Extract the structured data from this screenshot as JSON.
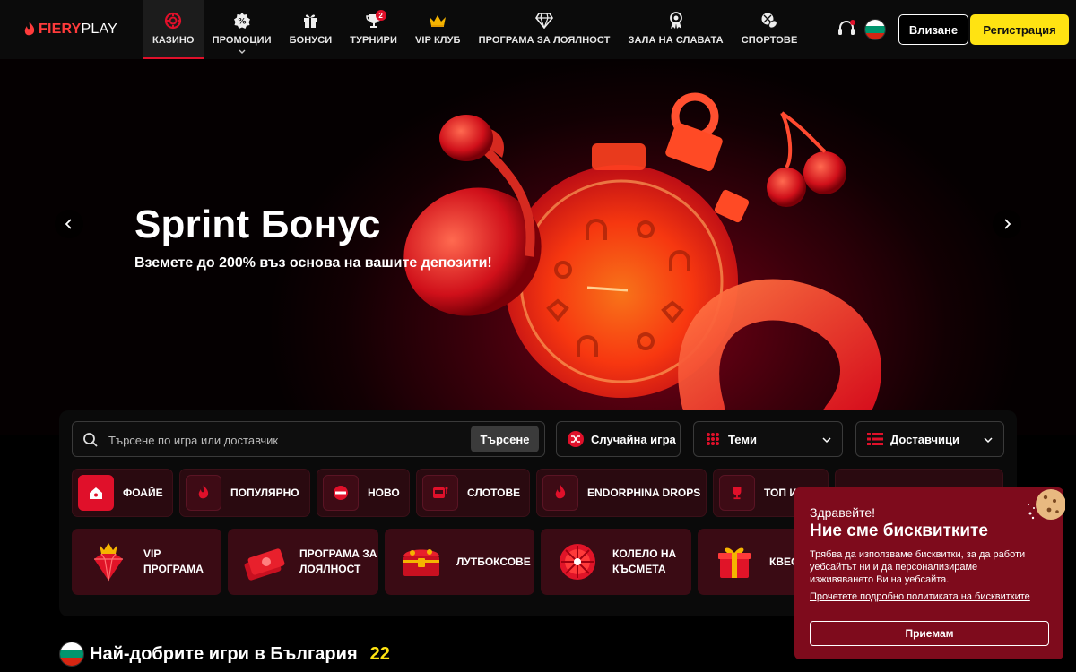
{
  "header": {
    "logo_fiery": "FIERY",
    "logo_play": "PLAY",
    "nav": [
      {
        "label": "КАЗИНО",
        "icon": "casino-chip-icon"
      },
      {
        "label": "ПРОМОЦИИ",
        "icon": "percent-badge-icon"
      },
      {
        "label": "БОНУСИ",
        "icon": "gift-icon"
      },
      {
        "label": "ТУРНИРИ",
        "icon": "trophy-icon",
        "badge": "2"
      },
      {
        "label": "VIP КЛУБ",
        "icon": "crown-icon"
      },
      {
        "label": "ПРОГРАМА ЗА ЛОЯЛНОСТ",
        "icon": "diamond-icon"
      },
      {
        "label": "ЗАЛА НА СЛАВАТА",
        "icon": "medal-icon"
      },
      {
        "label": "СПОРТОВЕ",
        "icon": "sports-ball-icon"
      }
    ],
    "login_label": "Влизане",
    "register_label": "Регистрация"
  },
  "hero": {
    "title": "Sprint Бонус",
    "subtitle": "Вземете до 200% въз основа на вашите депозити!"
  },
  "search": {
    "placeholder": "Търсене по игра или доставчик",
    "button": "Търсене"
  },
  "controls": {
    "random": "Случайна игра",
    "themes": "Теми",
    "providers": "Доставчици"
  },
  "categories": [
    {
      "label": "ФОАЙЕ",
      "icon": "home-icon"
    },
    {
      "label": "ПОПУЛЯРНО",
      "icon": "flame-icon"
    },
    {
      "label": "НОВО",
      "icon": "new-badge-icon"
    },
    {
      "label": "СЛОТОВЕ",
      "icon": "slot-machine-icon"
    },
    {
      "label": "ENDORPHINA DROPS",
      "icon": "flame-drop-icon"
    },
    {
      "label": "ТОП И",
      "icon": "trophy-icon"
    }
  ],
  "features": [
    {
      "line1": "VIP",
      "line2": "ПРОГРАМА",
      "icon": "ruby-crown-icon"
    },
    {
      "line1": "ПРОГРАМА ЗА",
      "line2": "ЛОЯЛНОСТ",
      "icon": "money-stack-icon"
    },
    {
      "line1": "ЛУТБОКСОВЕ",
      "line2": "",
      "icon": "treasure-chest-icon"
    },
    {
      "line1": "КОЛЕЛО НА",
      "line2": "КЪСМЕТА",
      "icon": "fortune-wheel-icon"
    },
    {
      "line1": "КВЕСТ",
      "line2": "",
      "icon": "gift-box-icon"
    }
  ],
  "best": {
    "title": "Най-добрите игри в България",
    "count": "22"
  },
  "cookie": {
    "hello": "Здравейте!",
    "title": "Ние сме бисквитките",
    "text": "Трябва да използваме бисквитки, за да работи уебсайтът ни и да персонализираме изживяването Ви на уебсайта.",
    "link": "Прочетете подробно политиката на бисквитките",
    "button": "Приемам"
  },
  "colors": {
    "accent_red": "#e0102a",
    "register_yellow": "#ffe312",
    "cookie_bg": "#7e0b1c"
  }
}
